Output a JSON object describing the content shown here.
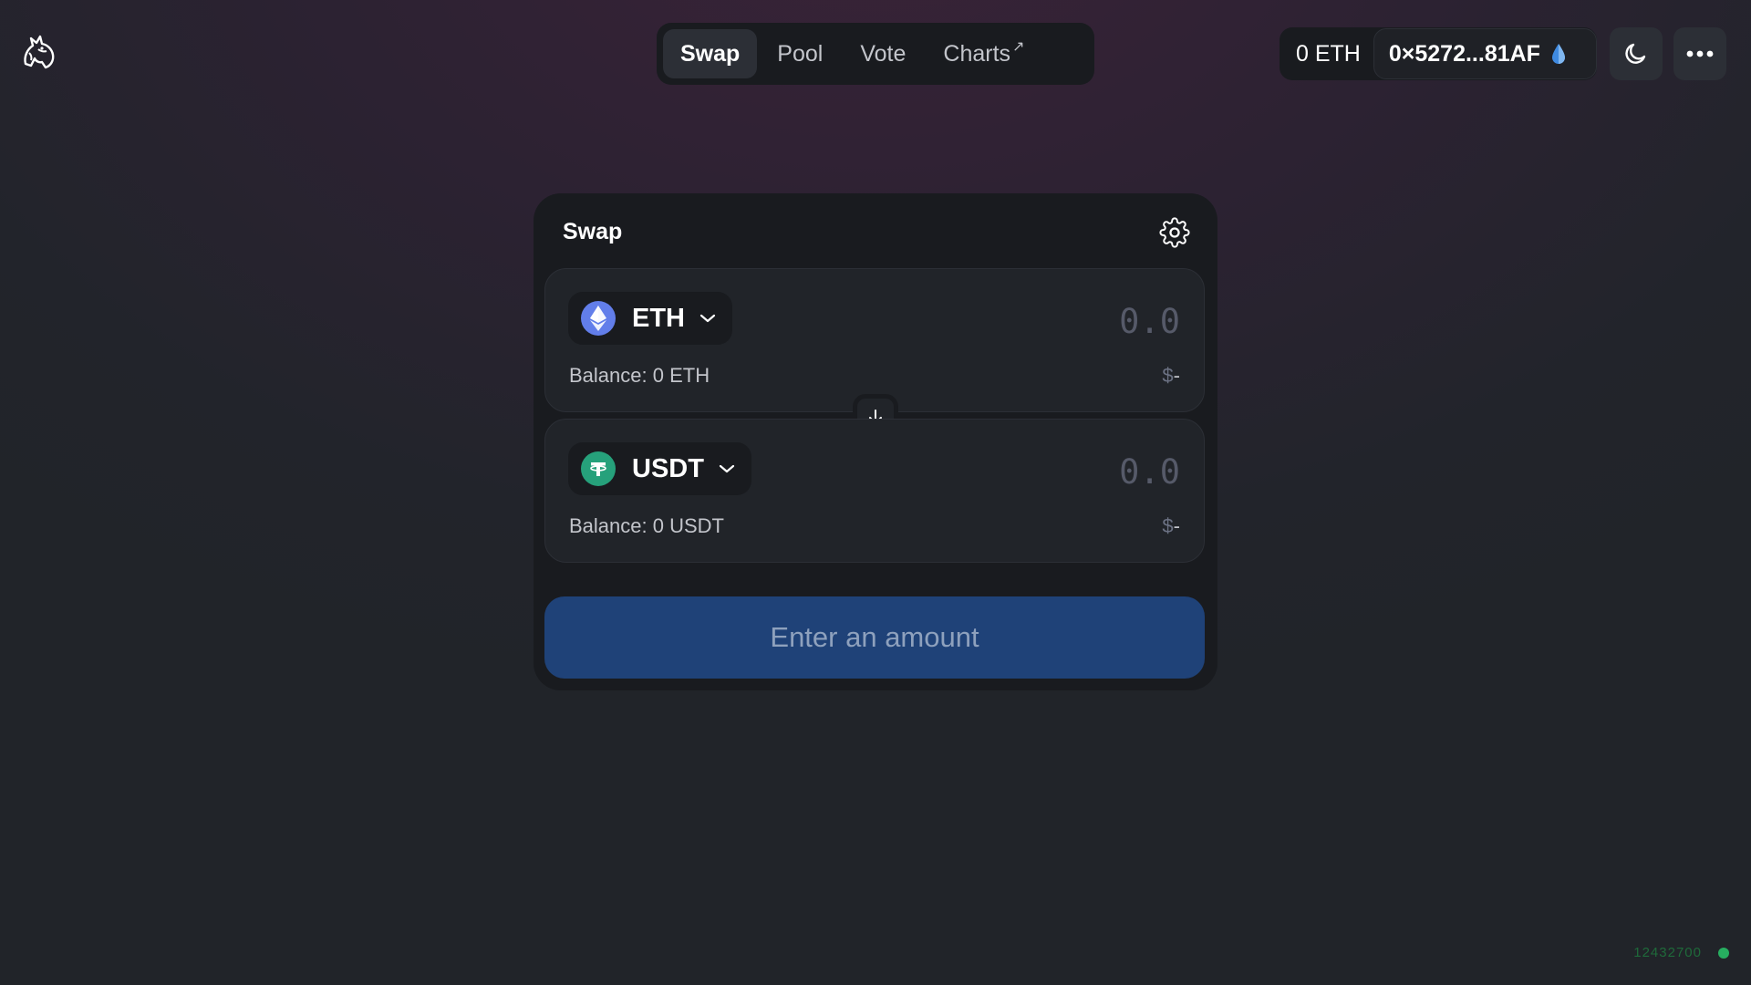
{
  "header": {
    "nav": [
      {
        "label": "Swap",
        "active": true
      },
      {
        "label": "Pool",
        "active": false
      },
      {
        "label": "Vote",
        "active": false
      },
      {
        "label": "Charts",
        "external": true
      }
    ],
    "balance": "0 ETH",
    "address": "0×5272...81AF"
  },
  "swap": {
    "title": "Swap",
    "input": {
      "token": "ETH",
      "token_icon": "ethereum-icon",
      "amount_placeholder": "0.0",
      "balance_label": "Balance: 0 ETH",
      "usd_symbol": "$",
      "usd_value": "-"
    },
    "output": {
      "token": "USDT",
      "token_icon": "tether-icon",
      "amount_placeholder": "0.0",
      "balance_label": "Balance: 0 USDT",
      "usd_symbol": "$",
      "usd_value": "-"
    },
    "cta_label": "Enter an amount"
  },
  "status": {
    "block_number": "12432700"
  },
  "colors": {
    "cta_bg": "#1f4278",
    "eth": "#627eea",
    "usdt": "#26a17b",
    "block_dot": "#27ae60"
  }
}
